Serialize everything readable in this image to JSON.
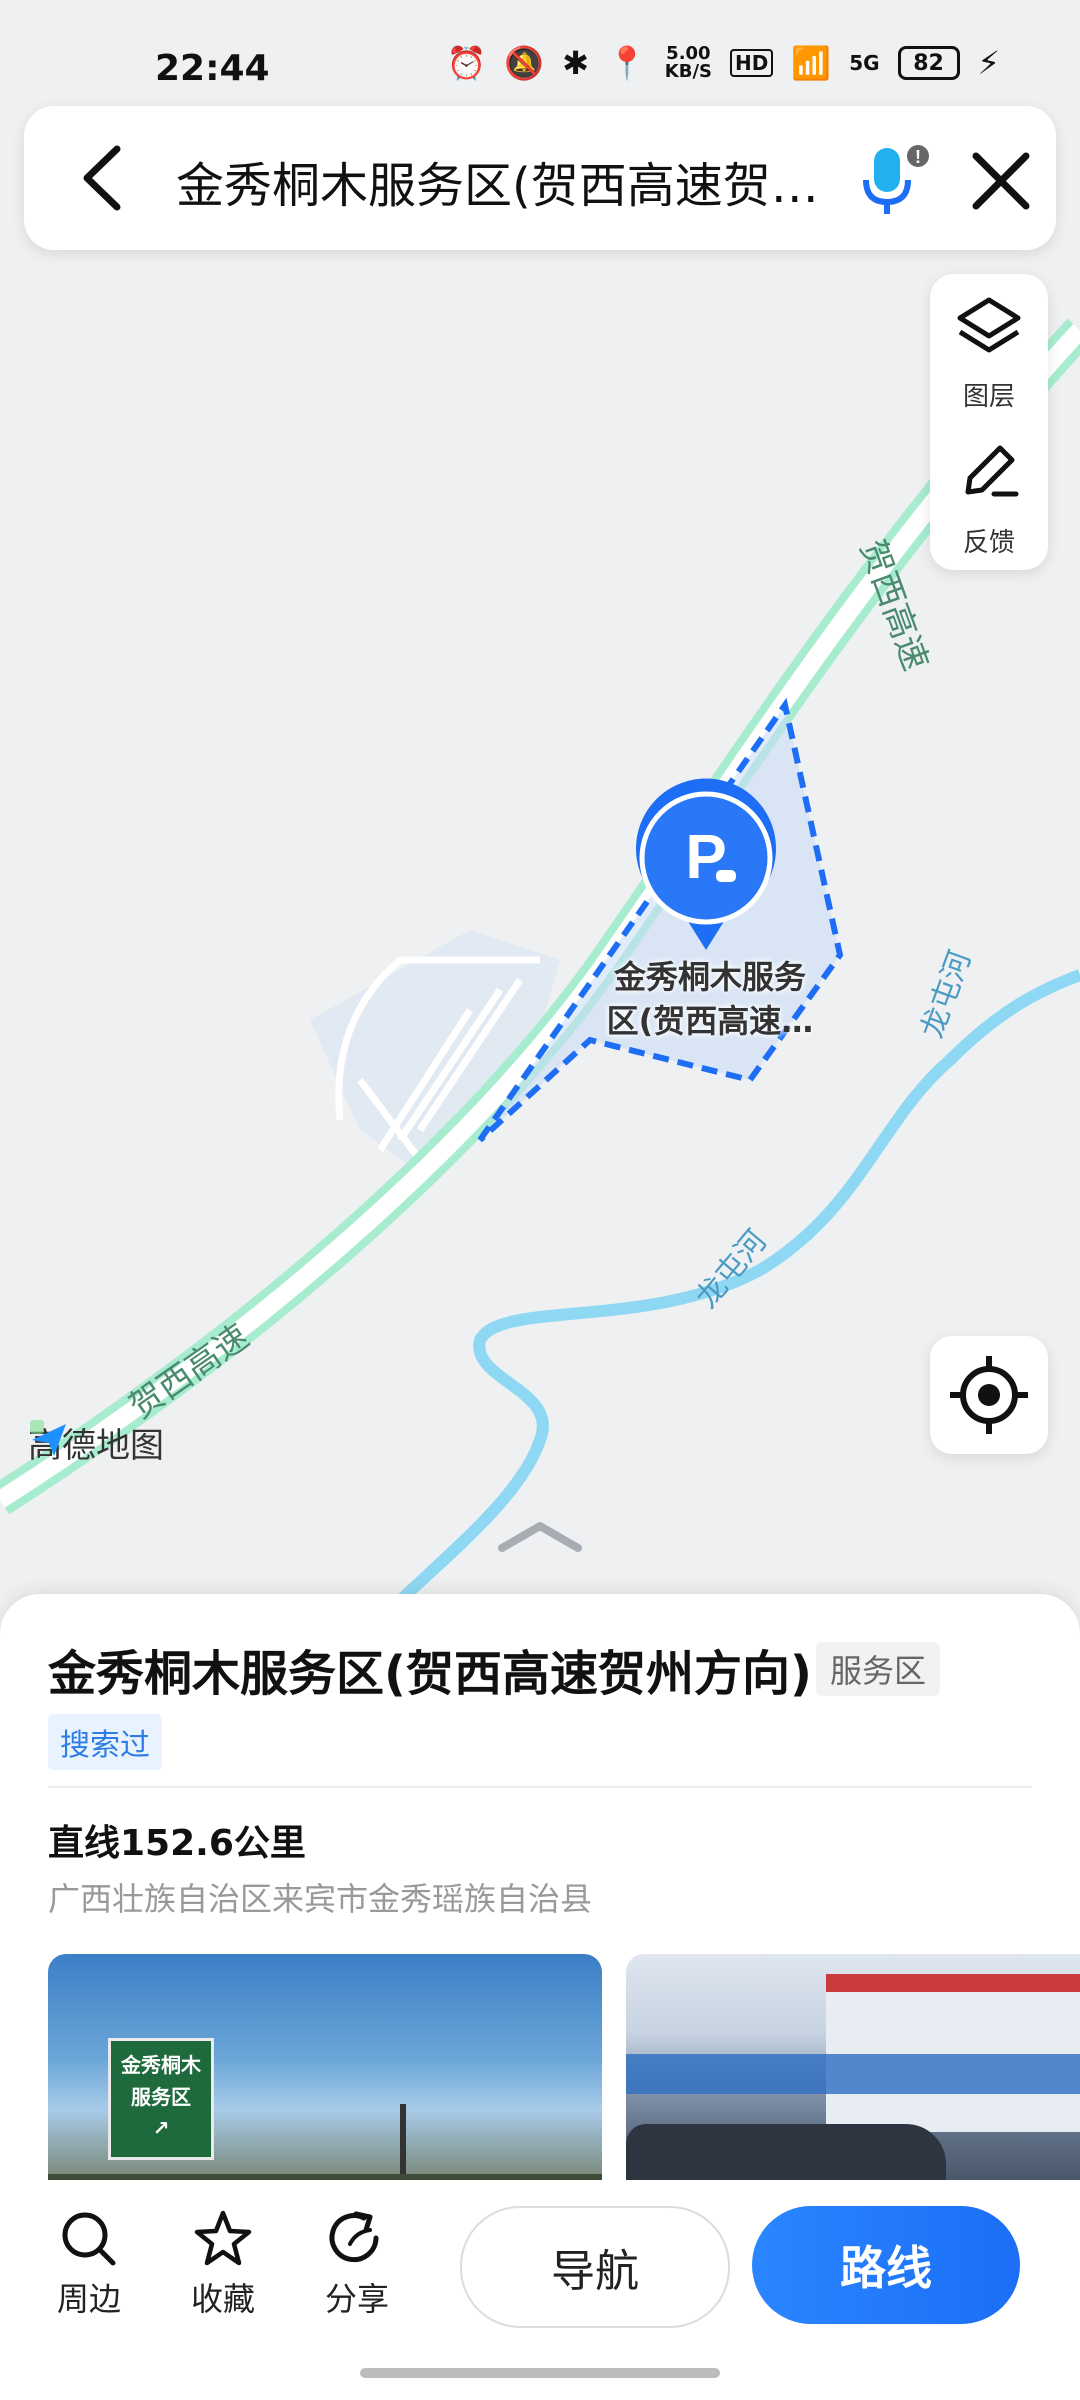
{
  "status_bar": {
    "time": "22:44",
    "net_speed_value": "5.00",
    "net_speed_unit": "KB/S",
    "hd": "HD",
    "signal": "5G",
    "battery": "82"
  },
  "search": {
    "query": "金秀桐木服务区(贺西高速贺…"
  },
  "map": {
    "layers_label": "图层",
    "feedback_label": "反馈",
    "poi_label_line1": "金秀桐木服务",
    "poi_label_line2": "区(贺西高速…",
    "road_label_top": "贺西高速",
    "road_label_bottom": "贺西高速",
    "river_label_1": "龙屯河",
    "river_label_2": "龙屯河",
    "watermark": "高德地图",
    "colors": {
      "road": "#7fe0b3",
      "river": "#7ad0ef",
      "poi_blue": "#1e6ef5"
    }
  },
  "place": {
    "title": "金秀桐木服务区(贺西高速贺州方向)",
    "category": "服务区",
    "history_tag": "搜索过",
    "distance": "直线152.6公里",
    "address": "广西壮族自治区来宾市金秀瑶族自治县",
    "photo1_sign": "金秀桐木服务区"
  },
  "actions": {
    "nearby": "周边",
    "favorite": "收藏",
    "share": "分享",
    "navigate": "导航",
    "route": "路线"
  }
}
